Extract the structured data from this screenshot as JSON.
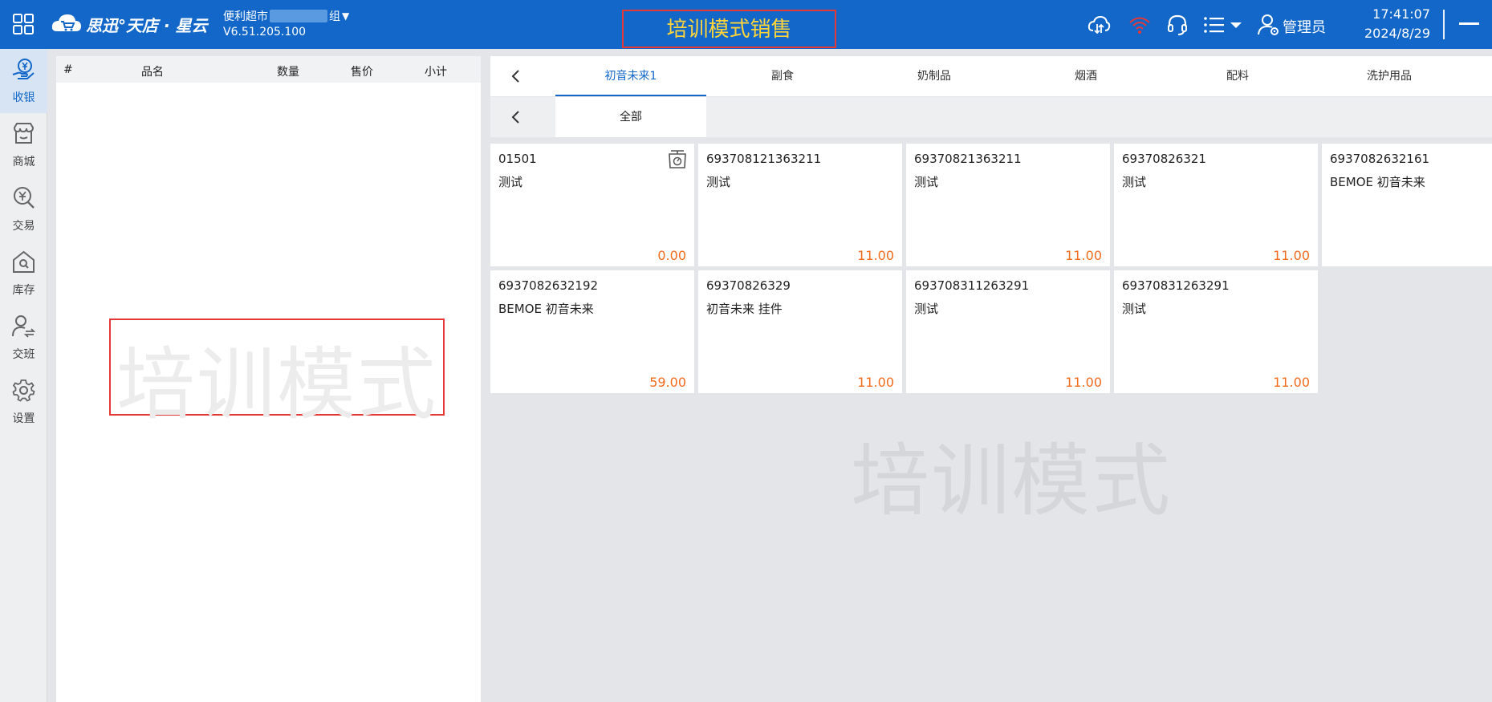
{
  "header": {
    "brand": "思迅°天店 · 星云",
    "store_name_prefix": "便利超市",
    "store_name_suffix": "组",
    "version": "V6.51.205.100",
    "mode_title": "培训模式销售",
    "admin_label": "管理员",
    "time": "17:41:07",
    "date": "2024/8/29"
  },
  "sidenav": {
    "items": [
      {
        "label": "收银",
        "icon": "cashier-icon"
      },
      {
        "label": "商城",
        "icon": "store-icon"
      },
      {
        "label": "交易",
        "icon": "yuan-search-icon"
      },
      {
        "label": "库存",
        "icon": "warehouse-icon"
      },
      {
        "label": "交班",
        "icon": "shift-icon"
      },
      {
        "label": "设置",
        "icon": "gear-icon"
      }
    ]
  },
  "cart": {
    "columns": [
      "#",
      "品名",
      "数量",
      "售价",
      "小计"
    ],
    "watermark": "培训模式"
  },
  "categories": {
    "tabs": [
      "初音未来1",
      "副食",
      "奶制品",
      "烟酒",
      "配料",
      "洗护用品"
    ],
    "active_tab": "初音未来1",
    "subtabs": [
      "全部"
    ]
  },
  "products": [
    {
      "code": "01501",
      "name": "测试",
      "price": "0.00",
      "icon": "scale-icon"
    },
    {
      "code": "693708121363211",
      "name": "测试",
      "price": "11.00"
    },
    {
      "code": "69370821363211",
      "name": "测试",
      "price": "11.00"
    },
    {
      "code": "69370826321",
      "name": "测试",
      "price": "11.00"
    },
    {
      "code": "6937082632161",
      "name": "BEMOE 初音未来",
      "price": ""
    },
    {
      "code": "6937082632192",
      "name": "BEMOE 初音未来",
      "price": "59.00"
    },
    {
      "code": "69370826329",
      "name": "初音未来 挂件",
      "price": "11.00"
    },
    {
      "code": "693708311263291",
      "name": "测试",
      "price": "11.00"
    },
    {
      "code": "69370831263291",
      "name": "测试",
      "price": "11.00"
    }
  ],
  "grid_watermark": "培训模式",
  "colors": {
    "header_bg": "#1267c9",
    "accent": "#1267c9",
    "price": "#f26b1d",
    "mode_title": "#ffd43a",
    "highlight_border": "#e53935"
  }
}
